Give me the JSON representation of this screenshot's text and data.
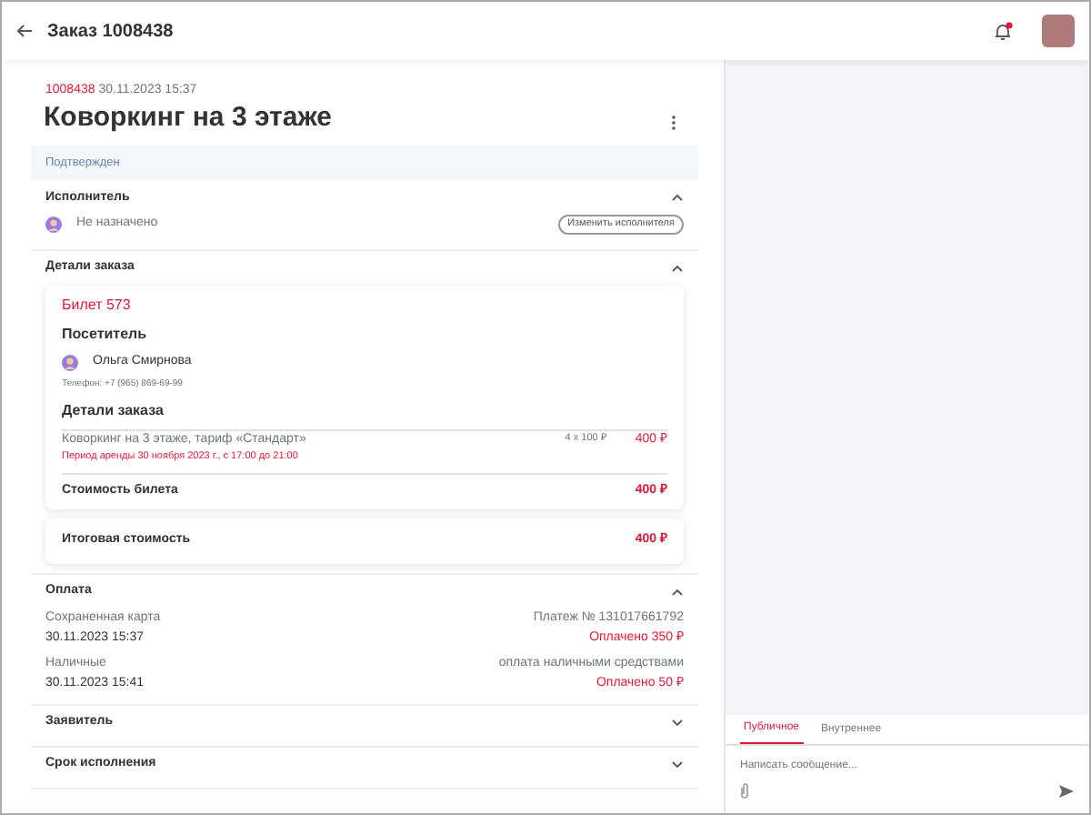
{
  "header": {
    "title": "Заказ 1008438",
    "notification": true
  },
  "order": {
    "number": "1008438",
    "datetime": "30.11.2023 15:37",
    "title": "Коворкинг на 3 этаже",
    "status": "Подтвержден"
  },
  "sections": [
    {
      "kind": "assignee",
      "title": "Исполнитель",
      "expanded": true,
      "assignee": "Не назначено",
      "button": "Изменить исполнителя"
    },
    {
      "kind": "details",
      "title": "Детали заказа",
      "expanded": true,
      "ticket": {
        "title": "Билет 573",
        "visitor_heading": "Посетитель",
        "visitor": "Ольга Смирнова",
        "phone": "Телефон: +7 (965) 869-69-99",
        "details_heading": "Детали заказа",
        "item": {
          "name": "Коворкинг на 3 этаже, тариф «Стандарт»",
          "period": "Период аренды 30 ноября 2023 г., с 17:00 до 21:00",
          "qty": "4 x 100 ₽",
          "price": "400 ₽"
        },
        "cost_label": "Стоимость билета",
        "cost": "400 ₽"
      },
      "total_label": "Итоговая стоимость",
      "total": "400 ₽"
    },
    {
      "kind": "payments",
      "title": "Оплата",
      "expanded": true,
      "payments": [
        {
          "method": "Сохраненная карта",
          "reference": "Платеж № 131017661792",
          "datetime": "30.11.2023 15:37",
          "amount": "Оплачено 350 ₽"
        },
        {
          "method": "Наличные",
          "reference": "оплата наличными средствами",
          "datetime": "30.11.2023 15:41",
          "amount": "Оплачено 50 ₽"
        }
      ]
    },
    {
      "kind": "plain",
      "title": "Заявитель",
      "expanded": false
    },
    {
      "kind": "plain",
      "title": "Срок исполнения",
      "expanded": false
    }
  ],
  "chat": {
    "tabs": [
      {
        "label": "Публичное",
        "selected": true
      },
      {
        "label": "Внутреннее",
        "selected": false
      }
    ],
    "placeholder": "Написать сообщение..."
  }
}
